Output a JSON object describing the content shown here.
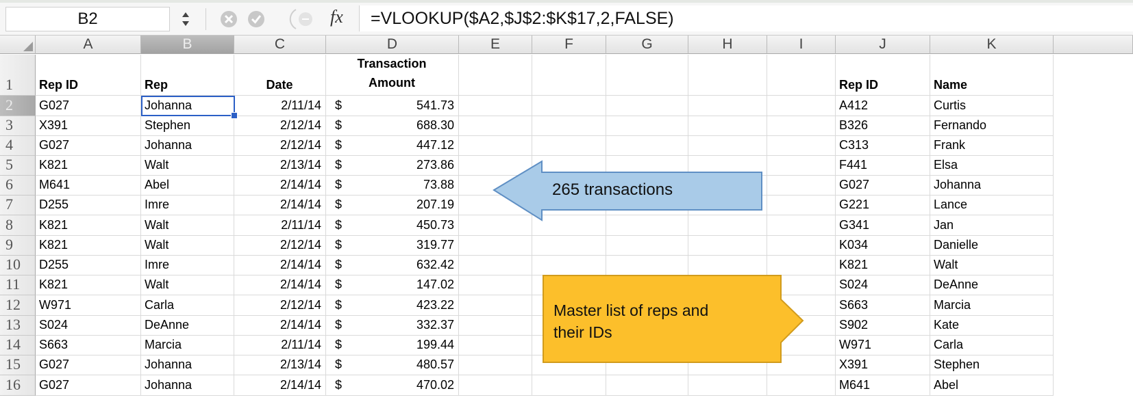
{
  "namebox": {
    "value": "B2"
  },
  "formula": {
    "text": "=VLOOKUP($A2,$J$2:$K$17,2,FALSE)",
    "fx_label": "fx"
  },
  "columns": [
    "A",
    "B",
    "C",
    "D",
    "E",
    "F",
    "G",
    "H",
    "I",
    "J",
    "K"
  ],
  "selected_column": "B",
  "selected_row": "2",
  "rows": [
    "1",
    "2",
    "3",
    "4",
    "5",
    "6",
    "7",
    "8",
    "9",
    "10",
    "11",
    "12",
    "13",
    "14",
    "15",
    "16"
  ],
  "headers": {
    "rep_id": "Rep ID",
    "rep": "Rep",
    "date": "Date",
    "amount_line1": "Transaction",
    "amount_line2": "Amount",
    "master_rep_id": "Rep ID",
    "master_name": "Name"
  },
  "currency_symbol": "$",
  "transactions": [
    {
      "id": "G027",
      "rep": "Johanna",
      "date": "2/11/14",
      "amount": "541.73"
    },
    {
      "id": "X391",
      "rep": "Stephen",
      "date": "2/12/14",
      "amount": "688.30"
    },
    {
      "id": "G027",
      "rep": "Johanna",
      "date": "2/12/14",
      "amount": "447.12"
    },
    {
      "id": "K821",
      "rep": "Walt",
      "date": "2/13/14",
      "amount": "273.86"
    },
    {
      "id": "M641",
      "rep": "Abel",
      "date": "2/14/14",
      "amount": "73.88"
    },
    {
      "id": "D255",
      "rep": "Imre",
      "date": "2/14/14",
      "amount": "207.19"
    },
    {
      "id": "K821",
      "rep": "Walt",
      "date": "2/11/14",
      "amount": "450.73"
    },
    {
      "id": "K821",
      "rep": "Walt",
      "date": "2/12/14",
      "amount": "319.77"
    },
    {
      "id": "D255",
      "rep": "Imre",
      "date": "2/14/14",
      "amount": "632.42"
    },
    {
      "id": "K821",
      "rep": "Walt",
      "date": "2/14/14",
      "amount": "147.02"
    },
    {
      "id": "W971",
      "rep": "Carla",
      "date": "2/12/14",
      "amount": "423.22"
    },
    {
      "id": "S024",
      "rep": "DeAnne",
      "date": "2/14/14",
      "amount": "332.37"
    },
    {
      "id": "S663",
      "rep": "Marcia",
      "date": "2/11/14",
      "amount": "199.44"
    },
    {
      "id": "G027",
      "rep": "Johanna",
      "date": "2/13/14",
      "amount": "480.57"
    },
    {
      "id": "G027",
      "rep": "Johanna",
      "date": "2/14/14",
      "amount": "470.02"
    }
  ],
  "master_list": [
    {
      "id": "A412",
      "name": "Curtis"
    },
    {
      "id": "B326",
      "name": "Fernando"
    },
    {
      "id": "C313",
      "name": "Frank"
    },
    {
      "id": "F441",
      "name": "Elsa"
    },
    {
      "id": "G027",
      "name": "Johanna"
    },
    {
      "id": "G221",
      "name": "Lance"
    },
    {
      "id": "G341",
      "name": "Jan"
    },
    {
      "id": "K034",
      "name": "Danielle"
    },
    {
      "id": "K821",
      "name": "Walt"
    },
    {
      "id": "S024",
      "name": "DeAnne"
    },
    {
      "id": "S663",
      "name": "Marcia"
    },
    {
      "id": "S902",
      "name": "Kate"
    },
    {
      "id": "W971",
      "name": "Carla"
    },
    {
      "id": "X391",
      "name": "Stephen"
    },
    {
      "id": "M641",
      "name": "Abel"
    }
  ],
  "callouts": {
    "transactions": {
      "text": "265 transactions",
      "color": "#a9cbe8"
    },
    "master": {
      "line1": "Master list of reps and",
      "line2": "their IDs",
      "color": "#fcbf2b"
    }
  },
  "icons": {
    "stepper": "stepper-icon",
    "cancel": "cancel-icon",
    "confirm": "confirm-icon",
    "function": "function-icon"
  }
}
